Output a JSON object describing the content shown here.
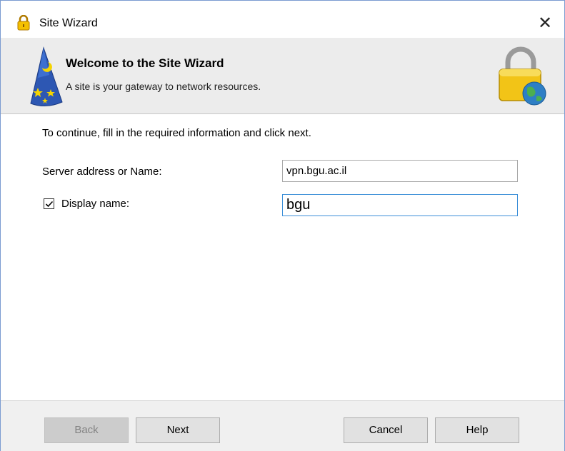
{
  "window": {
    "title": "Site Wizard",
    "close_glyph": "✕",
    "title_icon": "lock-icon"
  },
  "banner": {
    "title": "Welcome to the Site Wizard",
    "subtitle": "A site is your gateway to network resources.",
    "left_icon": "wizard-hat-icon",
    "right_icon": "lock-globe-icon"
  },
  "form": {
    "intro": "To continue, fill in the required information and click next.",
    "server_label": "Server address or Name:",
    "server_value": "vpn.bgu.ac.il",
    "display_label": "Display name:",
    "display_checked": true,
    "display_value": "bgu"
  },
  "buttons": {
    "back": "Back",
    "next": "Next",
    "cancel": "Cancel",
    "help": "Help"
  },
  "colors": {
    "banner_bg": "#ececec",
    "footer_bg": "#f0f0f0",
    "focus_border": "#3c8fd8"
  }
}
